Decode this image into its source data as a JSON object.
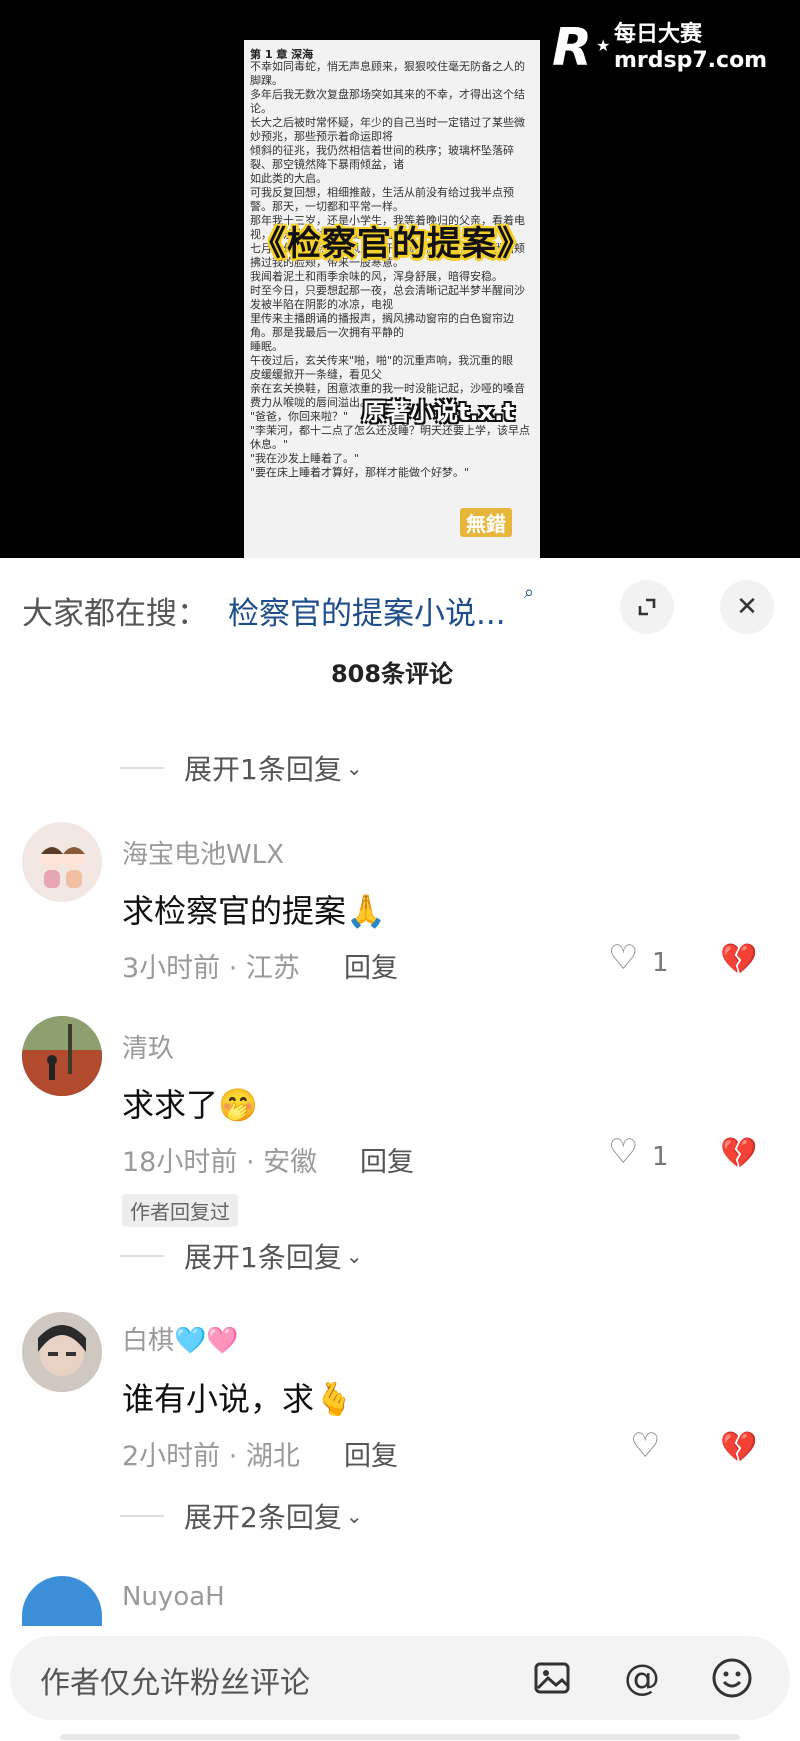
{
  "video": {
    "chapter_heading": "第 1 章 深海",
    "doc_lines": [
      "不幸如同毒蛇，悄无声息顾来，狠狠咬住毫无防备之人的",
      "脚踝。",
      "多年后我无数次复盘那场突如其来的不幸，才得出这个结",
      "论。",
      "长大之后被时常怀疑，年少的自己当时一定错过了某些微",
      "妙预兆，那些预示着命运即将",
      "倾斜的征兆，我仍然相信着世间的秩序；玻璃杯坠落碎",
      "裂、那空镜然降下暴雨倾盆，诸",
      "如此类的大启。",
      "可我反复回想，相细推敲，生活从前没有给过我半点预",
      "警。那天，一切都和平常一样。",
      "那年我十三岁，还是小学生，我等着晚归的父亲，看着电",
      "视，在沙发上浅浅睡去，时值",
      "七月中旬，闷热的夜风从敞开的窗户溢进来，拂过我面颊",
      "拂过我的脸颊，带来一股寒意。",
      "我闻着泥土和雨季余味的风，浑身舒展，暗得安稳。",
      "时至今日，只要想起那一夜，总会清晰记起半梦半醒间沙",
      "发被半陷在阴影的冰凉，电视",
      "里传来主播朗诵的播报声，搁风拂动窗帘的白色窗帘边",
      "角。那是我最后一次拥有平静的",
      "睡眠。",
      "午夜过后，玄关传来\"啪，啪\"的沉重声响，我沉重的眼",
      "皮缓缓掀开一条缝，看见父",
      "亲在玄关换鞋，困意浓重的我一时没能记起，沙哑的嗓音",
      "费力从喉咙的唇间溢出。",
      "\"爸爸，你回来啦？\"",
      "\"李茉河，都十二点了怎么还没睡？明天还要上学，该早点",
      "休息。\"",
      "\"我在沙发上睡着了。\"",
      "\"要在床上睡着才算好，那样才能做个好梦。\""
    ],
    "overlay_title": "《检察官的提案》",
    "overlay_source": "原著小说t.x.t",
    "overlay_badge": "無錯",
    "watermark_cn": "每日大赛",
    "watermark_url": "mrdsp7.com",
    "watermark_logo": "R"
  },
  "search": {
    "label": "大家都在搜：",
    "link": "检察官的提案小说..."
  },
  "comments_header": "808条评论",
  "expand_labels": {
    "first": "展开1条回复",
    "second": "展开1条回复",
    "third": "展开2条回复"
  },
  "comments": [
    {
      "name": "海宝电池WLX",
      "text": "求检察官的提案🙏",
      "meta": "3小时前 · 江苏",
      "reply": "回复",
      "likes": "1"
    },
    {
      "name": "清玖",
      "text": "求求了🤭",
      "meta": "18小时前 · 安徽",
      "reply": "回复",
      "likes": "1",
      "badge": "作者回复过"
    },
    {
      "name": "白棋🩵🩷",
      "text": "谁有小说，求🫰",
      "meta": "2小时前 · 湖北",
      "reply": "回复",
      "likes": ""
    },
    {
      "name": "NuyoaH"
    }
  ],
  "bottom_bar": {
    "placeholder": "作者仅允许粉丝评论"
  },
  "colors": {
    "link": "#1f4e8c",
    "title_outline": "#f5cf2a",
    "badge": "#e6b53a"
  }
}
